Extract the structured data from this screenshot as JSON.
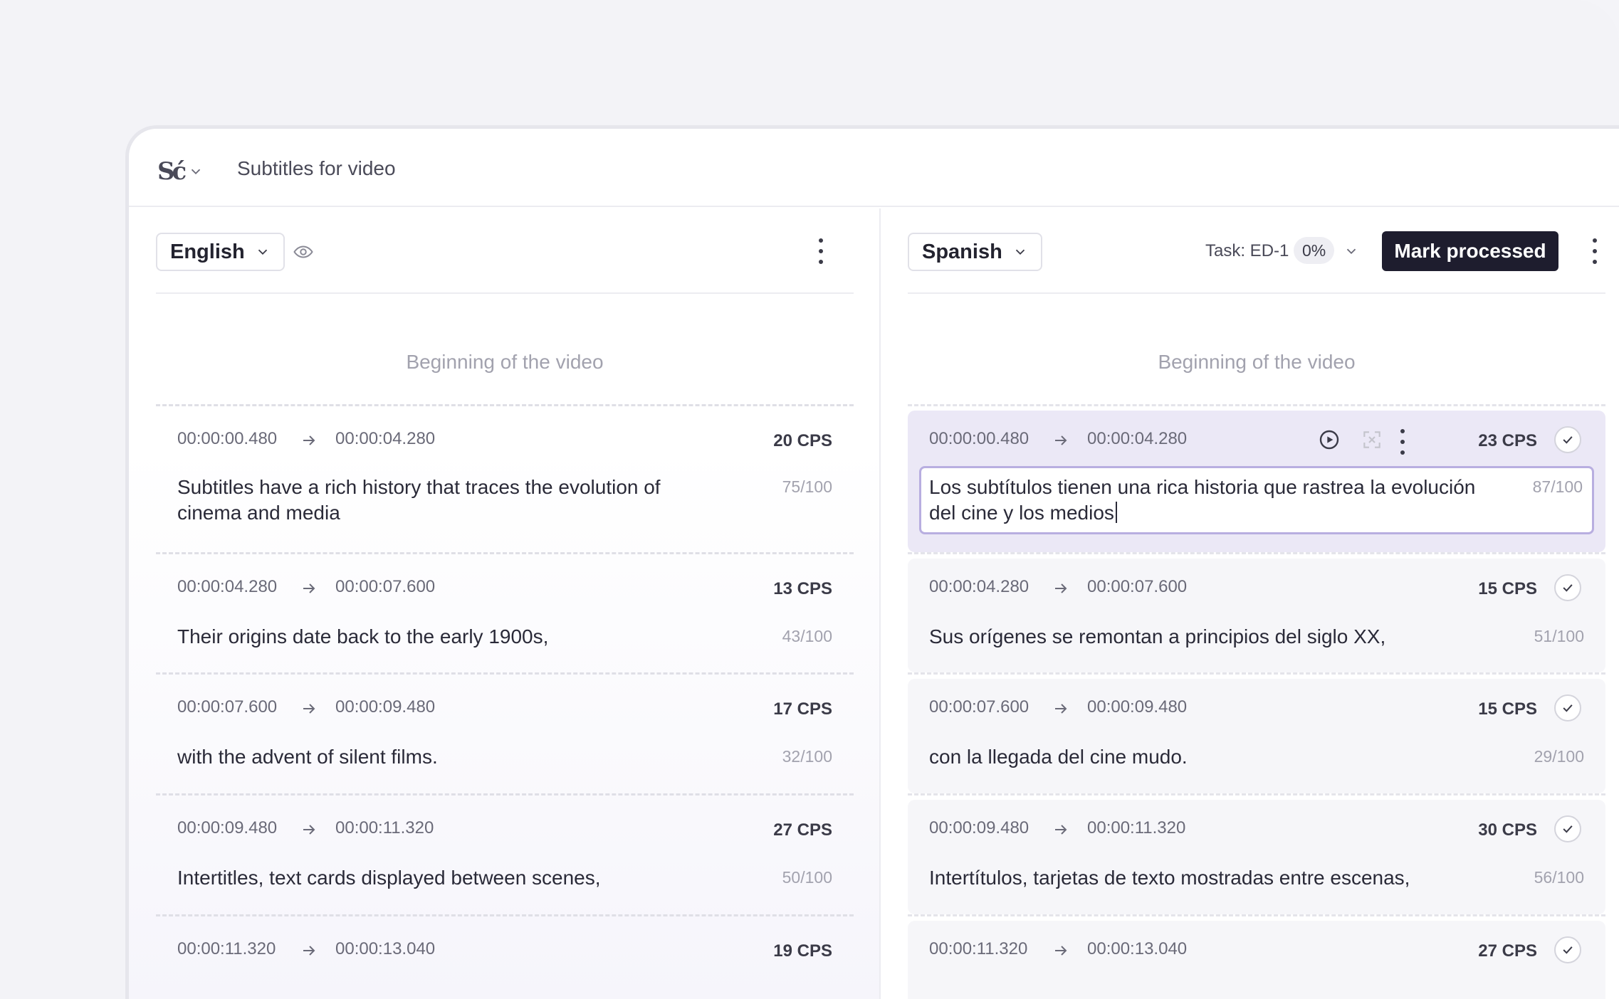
{
  "app": {
    "title": "Subtitles for video",
    "logo_text": "Sć",
    "logo_icon": "logo-mark"
  },
  "left": {
    "language": "English",
    "beginning": "Beginning of the video",
    "rows": [
      {
        "start": "00:00:00.480",
        "end": "00:00:04.280",
        "cps": "20 CPS",
        "text": "Subtitles have a rich history that traces the evolution of cinema and media",
        "count": "75/100"
      },
      {
        "start": "00:00:04.280",
        "end": "00:00:07.600",
        "cps": "13 CPS",
        "text": "Their origins date back to the early 1900s,",
        "count": "43/100"
      },
      {
        "start": "00:00:07.600",
        "end": "00:00:09.480",
        "cps": "17 CPS",
        "text": "with the advent of silent films.",
        "count": "32/100"
      },
      {
        "start": "00:00:09.480",
        "end": "00:00:11.320",
        "cps": "27 CPS",
        "text": " Intertitles, text cards displayed between scenes,",
        "count": "50/100"
      },
      {
        "start": "00:00:11.320",
        "end": "00:00:13.040",
        "cps": "19 CPS",
        "text": "",
        "count": ""
      }
    ]
  },
  "right": {
    "language": "Spanish",
    "task_label": "Task: ED-1",
    "task_progress": "0%",
    "mark_button": "Mark processed",
    "beginning": "Beginning of the video",
    "rows": [
      {
        "start": "00:00:00.480",
        "end": "00:00:04.280",
        "cps": "23 CPS",
        "text": "Los subtítulos tienen una rica historia que rastrea la evolución del cine y los medios",
        "count": "87/100",
        "active": true
      },
      {
        "start": "00:00:04.280",
        "end": "00:00:07.600",
        "cps": "15 CPS",
        "text": "Sus orígenes se remontan a principios del siglo XX,",
        "count": "51/100"
      },
      {
        "start": "00:00:07.600",
        "end": "00:00:09.480",
        "cps": "15 CPS",
        "text": "con la llegada del cine mudo.",
        "count": "29/100"
      },
      {
        "start": "00:00:09.480",
        "end": "00:00:11.320",
        "cps": "30 CPS",
        "text": "Intertítulos, tarjetas de texto mostradas entre escenas,",
        "count": "56/100"
      },
      {
        "start": "00:00:11.320",
        "end": "00:00:13.040",
        "cps": "27 CPS",
        "text": "",
        "count": ""
      }
    ]
  },
  "colors": {
    "accent": "#1e1d2e",
    "active_row": "#ebe8f6",
    "edit_border": "#b8aee0"
  }
}
